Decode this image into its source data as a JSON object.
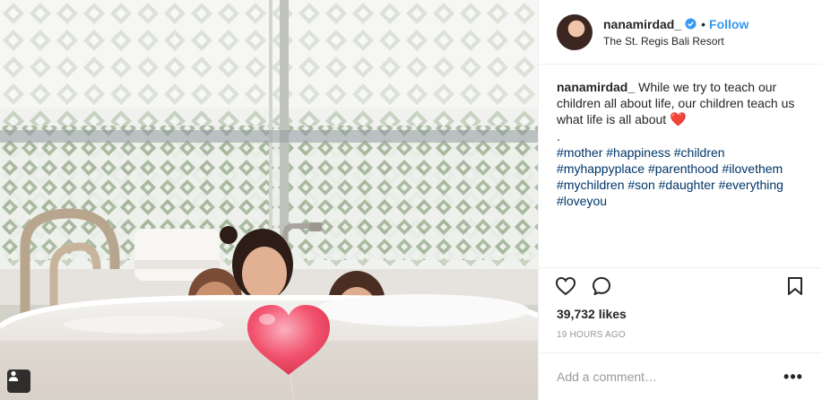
{
  "post": {
    "author": {
      "username": "nanamirdad_",
      "verified": true,
      "location": "The St. Regis Bali Resort",
      "follow_label": "Follow",
      "separator": "•"
    },
    "caption": {
      "text": "While we try to teach our children all about life, our children teach us what life is all about",
      "emoji": "❤️",
      "separator": ".",
      "hashtags": [
        "#mother",
        "#happiness",
        "#children",
        "#myhappyplace",
        "#parenthood",
        "#ilovethem",
        "#mychildren",
        "#son",
        "#daughter",
        "#everything",
        "#loveyou"
      ]
    },
    "likes_text": "39,732 likes",
    "timestamp": "19 HOURS AGO",
    "comment": {
      "placeholder": "Add a comment…"
    },
    "more_label": "•••"
  },
  "icons": {
    "like": "heart-outline-icon",
    "comment": "speech-bubble-icon",
    "save": "bookmark-icon",
    "photo_badge": "person-tag-icon",
    "verified": "verified-badge-icon"
  },
  "colors": {
    "link": "#3897f0",
    "hashtag": "#003569",
    "muted": "#999999",
    "verified": "#3897f0",
    "sticker_heart": "#f2536e"
  }
}
